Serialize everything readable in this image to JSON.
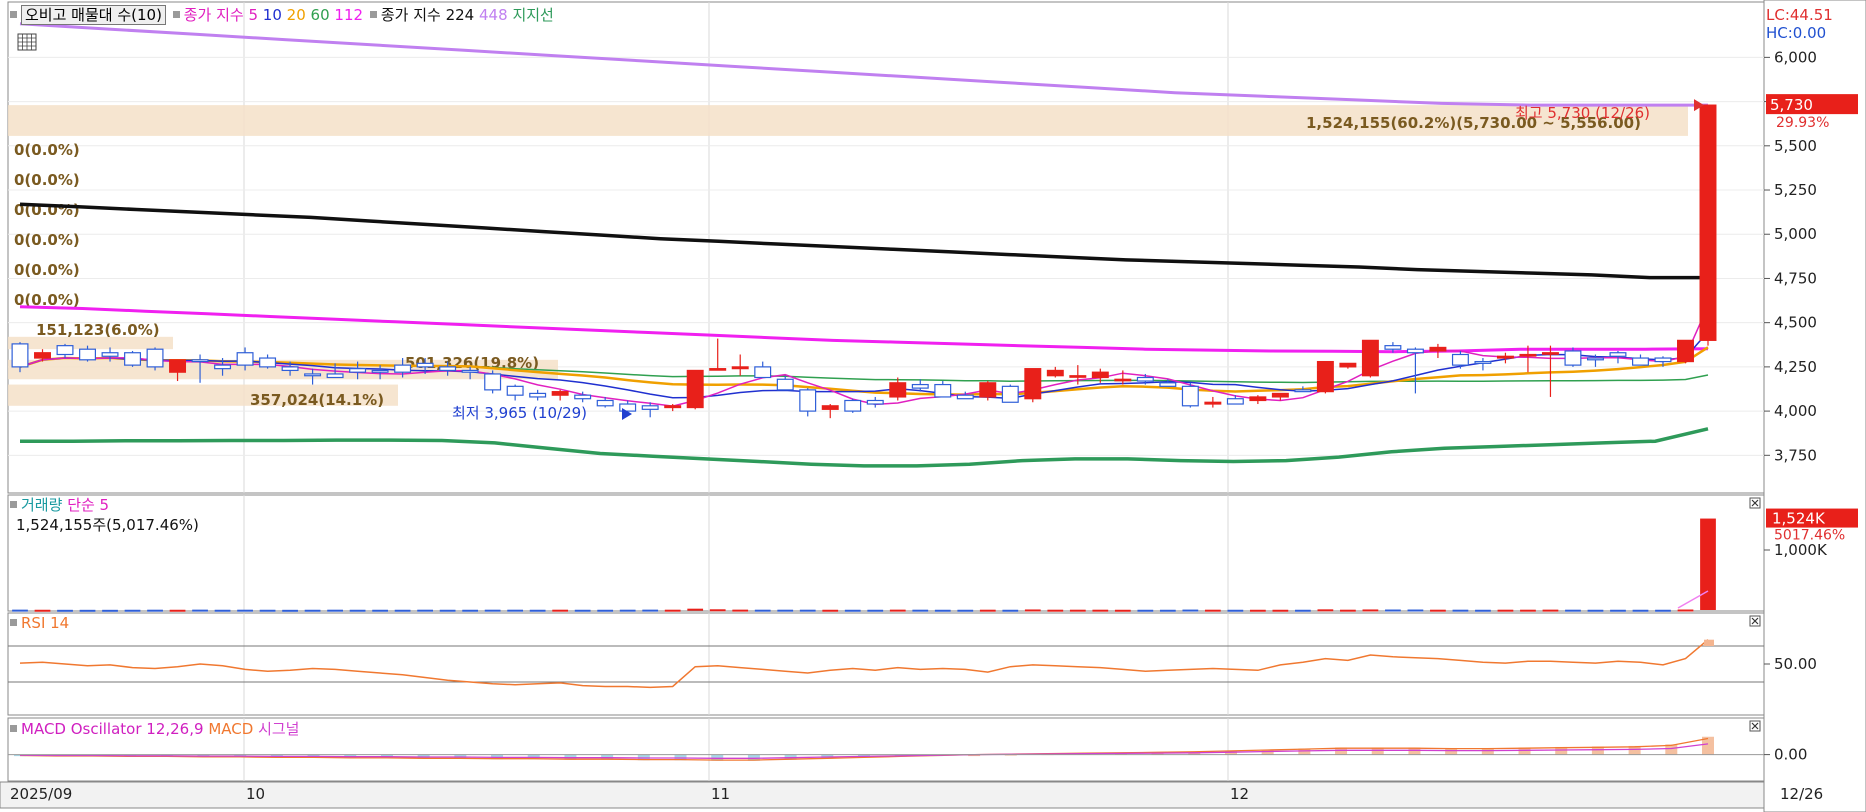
{
  "legend_main": {
    "period_button": "오비고 매물대 수(10)",
    "close_label": "종가 지수",
    "ma5": "5",
    "ma10": "10",
    "ma20": "20",
    "ma60": "60",
    "ma112": "112",
    "close_label2": "종가 지수",
    "ma224": "224",
    "ma448": "448",
    "support": "지지선"
  },
  "right_box": {
    "lc": "LC:44.51",
    "hc": "HC:0.00"
  },
  "volume_legend": {
    "label": "거래량",
    "ma": "단순 5",
    "value": "1,524,155주(5,017.46%)"
  },
  "rsi_legend": {
    "label": "RSI 14"
  },
  "macd_legend": {
    "label": "MACD Oscillator 12,26,9",
    "macd": "MACD",
    "signal": "시그널"
  },
  "price_axis_ticks": [
    "6,000",
    "5,750",
    "5,500",
    "5,250",
    "5,000",
    "4,750",
    "4,500",
    "4,250",
    "4,000",
    "3,750"
  ],
  "volume_axis_ticks": [
    "1,000K"
  ],
  "rsi_axis_ticks": [
    "50.00"
  ],
  "macd_axis_ticks": [
    "0.00"
  ],
  "x_axis_labels": [
    "2025/09",
    "10",
    "11",
    "12",
    "12/26"
  ],
  "current_price_tag": {
    "price": "5,730",
    "pct": "29.93%"
  },
  "volume_tag": {
    "value": "1,524K",
    "pct": "5017.46%"
  },
  "annotations": {
    "high": "최고 5,730 (12/26)",
    "low": "최저 3,965 (10/29)",
    "profile_top": "1,524,155(60.2%)(5,730.00 ~ 5,556.00)",
    "profile_a": "151,123(6.0%)",
    "profile_b": "501,326(19.8%)",
    "profile_c": "357,024(14.1%)",
    "zero_rows": [
      "0(0.0%)",
      "0(0.0%)",
      "0(0.0%)",
      "0(0.0%)",
      "0(0.0%)",
      "0(0.0%)"
    ]
  },
  "colors": {
    "up": "#e8201a",
    "down": "#2f5fd8",
    "ma5": "#e020c0",
    "ma10": "#2030d0",
    "ma20": "#f0a000",
    "ma60": "#30a050",
    "ma112": "#f020f0",
    "ma224": "#101010",
    "ma448": "#c080f0",
    "support": "#2e9a5a",
    "rsi": "#f07830",
    "macd": "#f07830",
    "signal": "#d040d0",
    "profile": "#f5e0c8"
  },
  "chart_data": {
    "type": "candlestick",
    "price_ylim": [
      3650,
      6200
    ],
    "candles": [
      [
        4380,
        4390,
        4220,
        4250
      ],
      [
        4300,
        4350,
        4280,
        4330
      ],
      [
        4370,
        4380,
        4300,
        4320
      ],
      [
        4350,
        4370,
        4280,
        4290
      ],
      [
        4330,
        4360,
        4280,
        4310
      ],
      [
        4330,
        4340,
        4250,
        4260
      ],
      [
        4350,
        4360,
        4230,
        4250
      ],
      [
        4220,
        4290,
        4170,
        4290
      ],
      [
        4290,
        4320,
        4160,
        4280
      ],
      [
        4260,
        4300,
        4200,
        4240
      ],
      [
        4330,
        4360,
        4230,
        4260
      ],
      [
        4300,
        4320,
        4240,
        4250
      ],
      [
        4250,
        4280,
        4200,
        4230
      ],
      [
        4210,
        4240,
        4150,
        4200
      ],
      [
        4210,
        4270,
        4190,
        4190
      ],
      [
        4240,
        4280,
        4180,
        4220
      ],
      [
        4230,
        4260,
        4180,
        4220
      ],
      [
        4260,
        4300,
        4190,
        4220
      ],
      [
        4270,
        4300,
        4210,
        4250
      ],
      [
        4250,
        4280,
        4200,
        4230
      ],
      [
        4230,
        4250,
        4180,
        4220
      ],
      [
        4210,
        4230,
        4100,
        4120
      ],
      [
        4140,
        4150,
        4060,
        4090
      ],
      [
        4100,
        4120,
        4060,
        4080
      ],
      [
        4090,
        4120,
        4060,
        4110
      ],
      [
        4090,
        4110,
        4050,
        4070
      ],
      [
        4060,
        4080,
        4020,
        4030
      ],
      [
        4040,
        4060,
        3990,
        4000
      ],
      [
        4030,
        4050,
        3965,
        4010
      ],
      [
        4020,
        4040,
        4000,
        4030
      ],
      [
        4020,
        4080,
        4010,
        4230
      ],
      [
        4240,
        4410,
        4230,
        4240
      ],
      [
        4240,
        4320,
        4200,
        4250
      ],
      [
        4250,
        4280,
        4200,
        4190
      ],
      [
        4180,
        4200,
        4120,
        4120
      ],
      [
        4120,
        4130,
        3970,
        4000
      ],
      [
        4010,
        4040,
        3960,
        4030
      ],
      [
        4060,
        4070,
        3990,
        4000
      ],
      [
        4060,
        4080,
        4020,
        4040
      ],
      [
        4080,
        4190,
        4060,
        4160
      ],
      [
        4150,
        4180,
        4110,
        4130
      ],
      [
        4150,
        4170,
        4120,
        4080
      ],
      [
        4090,
        4110,
        4070,
        4070
      ],
      [
        4080,
        4170,
        4060,
        4160
      ],
      [
        4140,
        4150,
        4050,
        4050
      ],
      [
        4070,
        4240,
        4050,
        4240
      ],
      [
        4200,
        4250,
        4190,
        4230
      ],
      [
        4200,
        4260,
        4150,
        4200
      ],
      [
        4190,
        4240,
        4160,
        4220
      ],
      [
        4180,
        4230,
        4150,
        4180
      ],
      [
        4190,
        4210,
        4150,
        4170
      ],
      [
        4160,
        4180,
        4140,
        4140
      ],
      [
        4140,
        4160,
        4020,
        4030
      ],
      [
        4040,
        4080,
        4020,
        4050
      ],
      [
        4070,
        4090,
        4040,
        4040
      ],
      [
        4060,
        4090,
        4040,
        4080
      ],
      [
        4080,
        4100,
        4060,
        4100
      ],
      [
        4120,
        4140,
        4110,
        4110
      ],
      [
        4110,
        4280,
        4100,
        4280
      ],
      [
        4250,
        4270,
        4240,
        4270
      ],
      [
        4200,
        4400,
        4190,
        4400
      ],
      [
        4370,
        4390,
        4330,
        4350
      ],
      [
        4350,
        4360,
        4100,
        4330
      ],
      [
        4340,
        4380,
        4300,
        4360
      ],
      [
        4320,
        4340,
        4240,
        4260
      ],
      [
        4280,
        4300,
        4230,
        4270
      ],
      [
        4300,
        4330,
        4270,
        4310
      ],
      [
        4320,
        4370,
        4220,
        4320
      ],
      [
        4330,
        4370,
        4080,
        4330
      ],
      [
        4340,
        4360,
        4250,
        4260
      ],
      [
        4300,
        4320,
        4250,
        4290
      ],
      [
        4330,
        4340,
        4270,
        4310
      ],
      [
        4300,
        4320,
        4260,
        4260
      ],
      [
        4300,
        4310,
        4250,
        4280
      ],
      [
        4280,
        4400,
        4270,
        4400
      ],
      [
        4400,
        5730,
        4370,
        5730
      ]
    ],
    "ma224": [
      5170,
      5155,
      5140,
      5125,
      5110,
      5095,
      5075,
      5055,
      5035,
      5015,
      4995,
      4975,
      4960,
      4945,
      4930,
      4915,
      4900,
      4885,
      4870,
      4855,
      4845,
      4835,
      4825,
      4815,
      4800,
      4790,
      4780,
      4770,
      4755,
      4755
    ],
    "ma448": [
      6190,
      6160,
      6130,
      6100,
      6070,
      6040,
      6010,
      5980,
      5950,
      5920,
      5890,
      5860,
      5830,
      5800,
      5780,
      5760,
      5740,
      5730,
      5730,
      5730
    ],
    "ma112": [
      4590,
      4580,
      4565,
      4550,
      4535,
      4520,
      4505,
      4490,
      4475,
      4460,
      4445,
      4430,
      4415,
      4400,
      4390,
      4380,
      4370,
      4360,
      4350,
      4345,
      4340,
      4338,
      4336,
      4340,
      4350,
      4350,
      4350,
      4352
    ],
    "support": [
      3830,
      3830,
      3832,
      3832,
      3834,
      3834,
      3836,
      3836,
      3834,
      3820,
      3790,
      3760,
      3745,
      3730,
      3715,
      3700,
      3690,
      3690,
      3700,
      3720,
      3730,
      3730,
      3720,
      3715,
      3720,
      3740,
      3770,
      3790,
      3800,
      3810,
      3820,
      3830,
      3900
    ],
    "volume_ylim": [
      0,
      1700
    ],
    "volume": [
      6,
      4,
      3,
      3,
      3,
      4,
      5,
      4,
      6,
      4,
      5,
      4,
      3,
      4,
      5,
      4,
      4,
      4,
      5,
      4,
      4,
      5,
      5,
      4,
      5,
      4,
      4,
      5,
      6,
      5,
      22,
      12,
      6,
      5,
      5,
      5,
      4,
      4,
      4,
      6,
      5,
      4,
      4,
      5,
      4,
      9,
      5,
      5,
      5,
      4,
      4,
      4,
      7,
      5,
      4,
      4,
      4,
      4,
      11,
      5,
      9,
      8,
      8,
      5,
      5,
      4,
      5,
      5,
      6,
      5,
      4,
      4,
      4,
      4,
      8,
      1524
    ],
    "rsi_ylim": [
      0,
      100
    ],
    "rsi": [
      51,
      52,
      50,
      48,
      49,
      46,
      45,
      47,
      50,
      48,
      44,
      42,
      43,
      45,
      44,
      42,
      40,
      38,
      35,
      32,
      30,
      28,
      27,
      28,
      29,
      26,
      25,
      25,
      24,
      25,
      47,
      48,
      46,
      44,
      42,
      40,
      43,
      45,
      43,
      46,
      44,
      45,
      44,
      41,
      47,
      49,
      48,
      47,
      46,
      44,
      42,
      43,
      44,
      45,
      44,
      43,
      49,
      52,
      56,
      54,
      60,
      58,
      57,
      56,
      54,
      52,
      51,
      53,
      53,
      52,
      51,
      53,
      52,
      49,
      56,
      77
    ],
    "macd_ylim": [
      -40,
      60
    ],
    "macd": [
      -2,
      -3,
      -3,
      -4,
      -4,
      -5,
      -5,
      -6,
      -6,
      -7,
      -7,
      -8,
      -8,
      -9,
      -9,
      -10,
      -10,
      -11,
      -11,
      -12,
      -12,
      -10,
      -8,
      -6,
      -4,
      -2,
      0,
      1,
      2,
      3,
      4,
      5,
      6,
      8,
      10,
      12,
      14,
      14,
      14,
      13,
      13,
      14,
      15,
      16,
      17,
      20,
      35
    ]
  }
}
